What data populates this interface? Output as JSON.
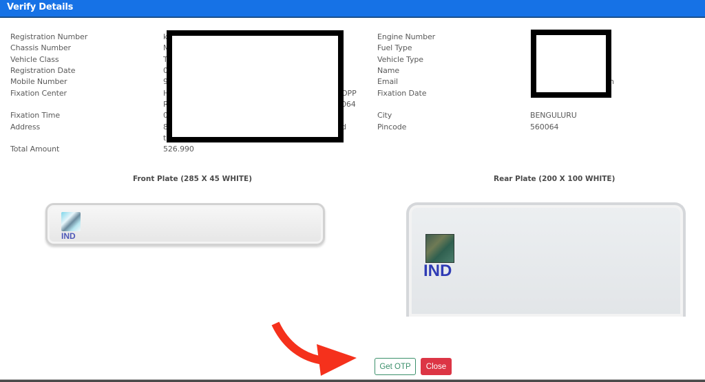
{
  "header": {
    "title": "Verify Details"
  },
  "details_left": [
    {
      "label": "Registration Number",
      "value": "k"
    },
    {
      "label": "Chassis Number",
      "value": "M"
    },
    {
      "label": "Vehicle Class",
      "value": "T"
    },
    {
      "label": "Registration Date",
      "value": "0"
    },
    {
      "label": "Mobile Number",
      "value": "9"
    },
    {
      "label": "Fixation Center",
      "value": "H",
      "value_line2": "R",
      "value_tail1": "OPP",
      "value_tail2": "064"
    },
    {
      "label": "Fixation Time",
      "value": "0"
    },
    {
      "label": "Address",
      "value": "8",
      "value_line2": "t",
      "value_tail1": "d"
    },
    {
      "label": "Total Amount",
      "value": "526.990"
    }
  ],
  "details_right": [
    {
      "label": "Engine Number",
      "value": ""
    },
    {
      "label": "Fuel Type",
      "value": ""
    },
    {
      "label": "Vehicle Type",
      "value": ""
    },
    {
      "label": "Name",
      "value": ""
    },
    {
      "label": "Email",
      "value": "",
      "value_tail": "n"
    },
    {
      "label": "Fixation Date",
      "value": ""
    },
    {
      "label": "City",
      "value": "BENGULURU"
    },
    {
      "label": "Pincode",
      "value": "560064"
    }
  ],
  "plates": {
    "front": {
      "title": "Front Plate (285 X 45 WHITE)",
      "country_code": "IND"
    },
    "rear": {
      "title": "Rear Plate (200 X 100 WHITE)",
      "country_code": "IND"
    }
  },
  "actions": {
    "get_otp_label": "Get OTP",
    "close_label": "Close"
  },
  "colors": {
    "header": "#1672e6",
    "otp_button": "#3a8f6a",
    "close_button": "#dc3545",
    "annotation_arrow": "#f5311c"
  }
}
